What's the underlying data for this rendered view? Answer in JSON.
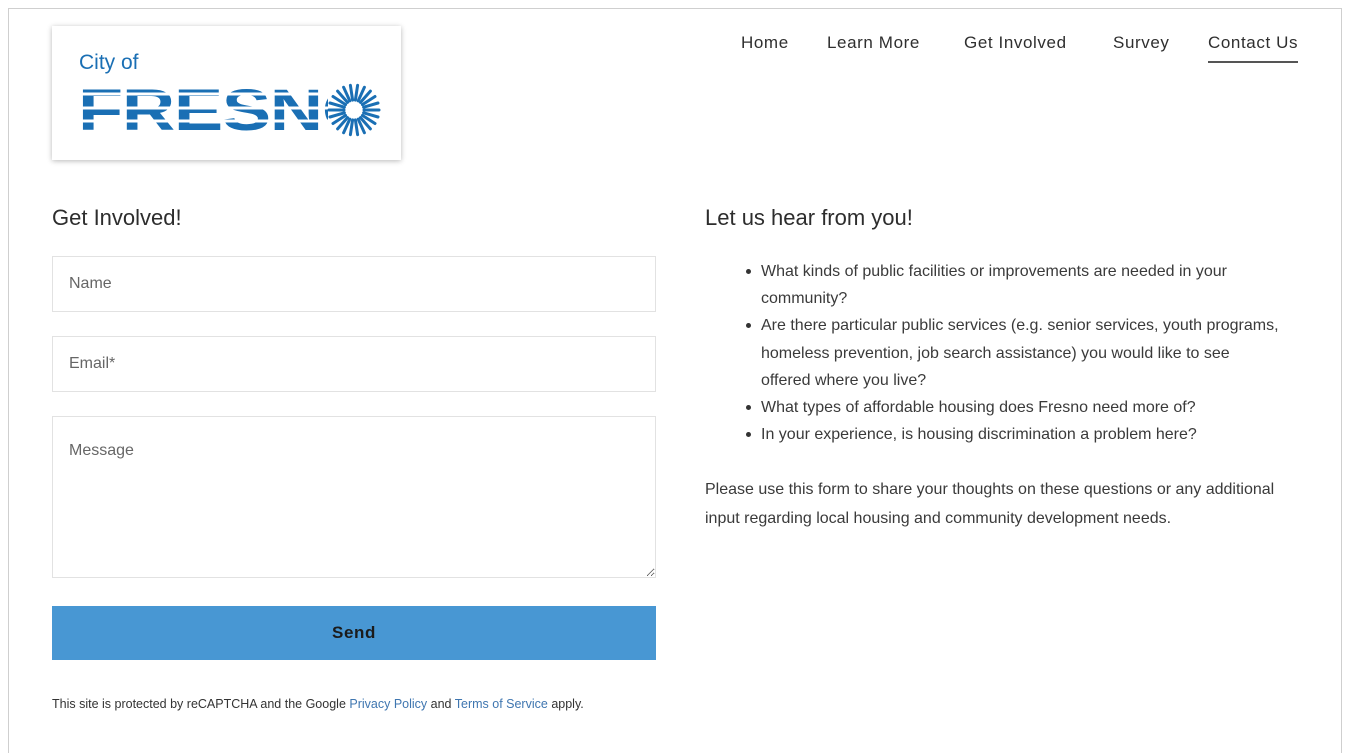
{
  "brand": {
    "logo_small": "City of",
    "logo_large": "FRESNO",
    "logo_color": "#1a6fb4"
  },
  "nav": {
    "items": [
      {
        "label": "Home",
        "active": false
      },
      {
        "label": "Learn More",
        "active": false
      },
      {
        "label": "Get Involved",
        "active": false
      },
      {
        "label": "Survey",
        "active": false
      },
      {
        "label": "Contact Us",
        "active": true
      }
    ]
  },
  "form": {
    "heading": "Get Involved!",
    "name_placeholder": "Name",
    "email_placeholder": "Email*",
    "message_placeholder": "Message",
    "send_label": "Send",
    "send_color": "#4897d3"
  },
  "recaptcha": {
    "prefix": "This site is protected by reCAPTCHA and the Google ",
    "privacy_link": "Privacy Policy",
    "and": " and ",
    "terms_link": "Terms of Service",
    "suffix": " apply."
  },
  "info": {
    "heading": "Let us hear from you!",
    "questions": [
      " What kinds of public facilities or improvements are needed in your community?",
      "Are there particular public services (e.g. senior services, youth programs, homeless prevention, job search assistance) you would like to see offered where you live?",
      "What types of affordable housing does Fresno need more of?",
      "In your experience, is housing discrimination a problem here?"
    ],
    "paragraph": "Please use this form to share your thoughts on these questions or any additional input regarding local housing and community development needs."
  }
}
